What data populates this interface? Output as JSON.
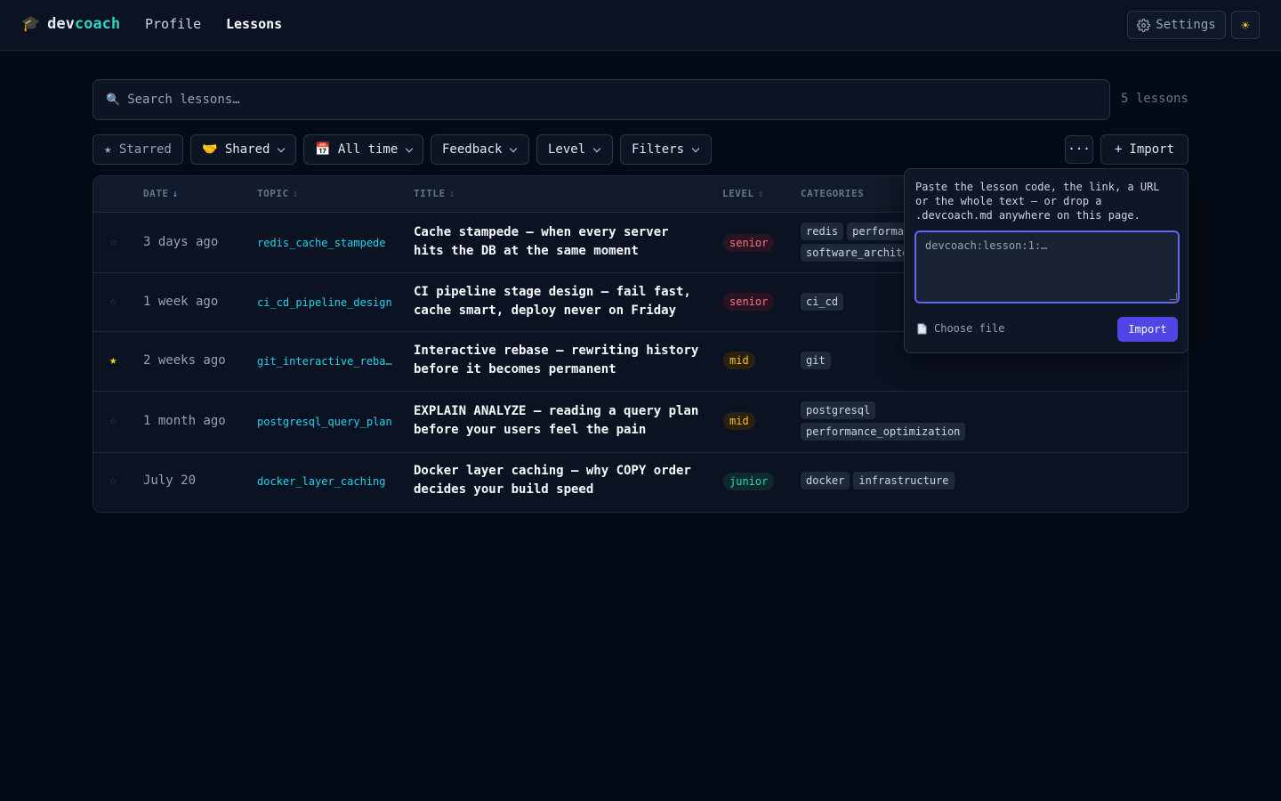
{
  "app": {
    "brand_icon": "🎓",
    "brand_part1": "dev",
    "brand_part2": "coach",
    "nav": [
      {
        "label": "Profile",
        "active": false
      },
      {
        "label": "Lessons",
        "active": true
      }
    ],
    "settings_label": "Settings",
    "theme_icon": "sun-icon"
  },
  "search": {
    "placeholder": "Search lessons…",
    "count_label": "5 lessons"
  },
  "filters": {
    "starred": "★ Starred",
    "shared": "🤝 Shared",
    "time": "📅 All time",
    "feedback": "Feedback",
    "level": "Level",
    "filters": "Filters",
    "more": "···",
    "import": "Import"
  },
  "table": {
    "columns": [
      "DATE",
      "TOPIC",
      "TITLE",
      "LEVEL",
      "CATEGORIES"
    ],
    "rows": [
      {
        "starred": false,
        "date": "3 days ago",
        "topic": "redis_cache_stampede",
        "title": "Cache stampede — when every server hits the DB at the same moment",
        "level": "senior",
        "categories": [
          "redis",
          "performance",
          "software_architecture"
        ]
      },
      {
        "starred": false,
        "date": "1 week ago",
        "topic": "ci_cd_pipeline_design",
        "title": "CI pipeline stage design — fail fast, cache smart, deploy never on Friday",
        "level": "senior",
        "categories": [
          "ci_cd"
        ]
      },
      {
        "starred": true,
        "date": "2 weeks ago",
        "topic": "git_interactive_rebase",
        "title": "Interactive rebase — rewriting history before it becomes permanent",
        "level": "mid",
        "categories": [
          "git"
        ]
      },
      {
        "starred": false,
        "date": "1 month ago",
        "topic": "postgresql_query_plan",
        "title": "EXPLAIN ANALYZE — reading a query plan before your users feel the pain",
        "level": "mid",
        "categories": [
          "postgresql",
          "performance_optimization"
        ]
      },
      {
        "starred": false,
        "date": "July 20",
        "topic": "docker_layer_caching",
        "title": "Docker layer caching — why COPY order decides your build speed",
        "level": "junior",
        "categories": [
          "docker",
          "infrastructure"
        ]
      }
    ]
  },
  "import_popover": {
    "help_text": "Paste the lesson code, the link, a URL or the whole text — or drop a .devcoach.md anywhere on this page.",
    "placeholder": "devcoach:lesson:1:…",
    "choose_file": "Choose file",
    "submit": "Import"
  }
}
